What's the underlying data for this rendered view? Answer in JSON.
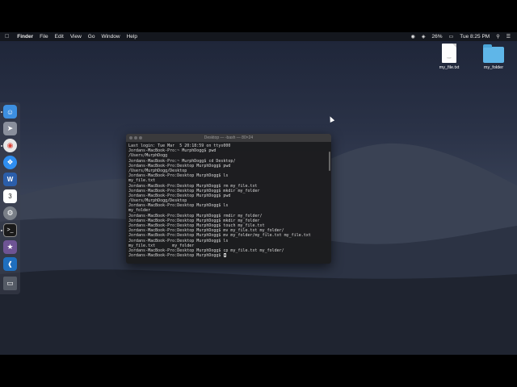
{
  "menubar": {
    "apple_icon": "apple-icon",
    "app_name": "Finder",
    "items": [
      "File",
      "Edit",
      "View",
      "Go",
      "Window",
      "Help"
    ],
    "battery": "26%",
    "clock": "Tue 8:25 PM"
  },
  "desktop": {
    "icons": [
      {
        "label": "my_file.txt",
        "ext": "TXT",
        "type": "document"
      },
      {
        "label": "my_folder",
        "type": "folder"
      }
    ]
  },
  "dock": {
    "apps": [
      "finder-icon",
      "launchpad-icon",
      "chrome-icon",
      "safari-icon",
      "word-icon",
      "calendar-icon",
      "system-preferences-icon",
      "terminal-icon",
      "github-icon",
      "vscode-icon",
      "trash-icon"
    ],
    "calendar_day": "3"
  },
  "terminal": {
    "title": "Desktop — -bash — 80×24",
    "lines": [
      "Last login: Tue Mar  5 20:18:59 on ttys000",
      "Jordans-MacBook-Pro:~ MurphDogg$ pwd",
      "/Users/MurphDogg",
      "Jordans-MacBook-Pro:~ MurphDogg$ cd Desktop/",
      "Jordans-MacBook-Pro:Desktop MurphDogg$ pwd",
      "/Users/MurphDogg/Desktop",
      "Jordans-MacBook-Pro:Desktop MurphDogg$ ls",
      "my_file.txt",
      "Jordans-MacBook-Pro:Desktop MurphDogg$ rm my_file.txt",
      "Jordans-MacBook-Pro:Desktop MurphDogg$ mkdir my_folder",
      "Jordans-MacBook-Pro:Desktop MurphDogg$ pwd",
      "/Users/MurphDogg/Desktop",
      "Jordans-MacBook-Pro:Desktop MurphDogg$ ls",
      "my_folder",
      "Jordans-MacBook-Pro:Desktop MurphDogg$ rmdir my_folder/",
      "Jordans-MacBook-Pro:Desktop MurphDogg$ mkdir my_folder",
      "Jordans-MacBook-Pro:Desktop MurphDogg$ touch my_file.txt",
      "Jordans-MacBook-Pro:Desktop MurphDogg$ mv my_file.txt my_folder/",
      "Jordans-MacBook-Pro:Desktop MurphDogg$ mv my_folder/my_file.txt my_file.txt",
      "Jordans-MacBook-Pro:Desktop MurphDogg$ ls",
      "my_file.txt       my_folder",
      "Jordans-MacBook-Pro:Desktop MurphDogg$ cp my_file.txt my_folder/"
    ],
    "prompt": "Jordans-MacBook-Pro:Desktop MurphDogg$ "
  }
}
